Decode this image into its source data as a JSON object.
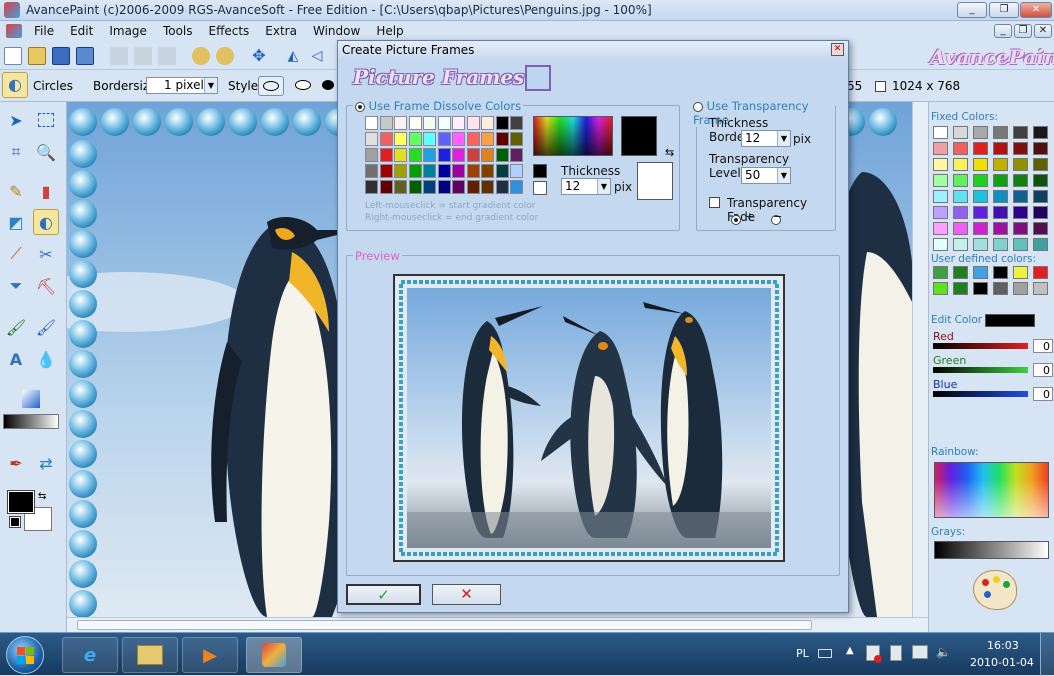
{
  "window": {
    "title": "AvancePaint (c)2006-2009 RGS-AvanceSoft - Free Edition - [C:\\Users\\qbap\\Pictures\\Penguins.jpg - 100%]",
    "controls": [
      "_",
      "❐",
      "✕"
    ],
    "inner_controls": [
      "_",
      "❐",
      "✕"
    ]
  },
  "menu": [
    "File",
    "Edit",
    "Image",
    "Tools",
    "Effects",
    "Extra",
    "Window",
    "Help"
  ],
  "brand": "AvancePaint",
  "toolbar2": {
    "tool_name": "Circles",
    "bordersize_label": "Bordersize:",
    "bordersize_value": "1 pixel",
    "style_label": "Style:",
    "coord_fragment": "55",
    "image_size": "1024 x 768"
  },
  "dialog": {
    "title": "Create Picture Frames",
    "logo_text": "Picture Frames",
    "dissolve": {
      "label": "Use Frame Dissolve Colors",
      "thickness_label": "Thickness",
      "thickness_value": "12",
      "unit": "pix",
      "hint_left": "Left-mouseclick = start gradient color",
      "hint_right": "Right-mouseclick = end gradient color"
    },
    "transparency": {
      "label": "Use Transparency Frame",
      "thickness_label": "Thickness",
      "border_label": "Border",
      "border_value": "12",
      "unit": "pix",
      "transparency_label": "Transparency",
      "level_label": "Level",
      "level_value": "50",
      "fade_label": "Transparency Fade",
      "plus": "+",
      "minus": "−"
    },
    "preview_label": "Preview",
    "ok_symbol": "✓",
    "cancel_symbol": "✕"
  },
  "right_panel": {
    "fixed_colors_label": "Fixed Colors:",
    "user_colors_label": "User defined colors:",
    "edit_color_label": "Edit Color",
    "red_label": "Red",
    "green_label": "Green",
    "blue_label": "Blue",
    "red_value": "0",
    "green_value": "0",
    "blue_value": "0",
    "rainbow_label": "Rainbow:",
    "grays_label": "Grays:"
  },
  "taskbar": {
    "lang": "PL",
    "time": "16:03",
    "date": "2010-01-04"
  },
  "palette_colors": [
    "#ffffff",
    "#c8c8c8",
    "#fff0f0",
    "#fffff0",
    "#f0fff0",
    "#f0ffff",
    "#fff0ff",
    "#ffe4f0",
    "#ffeedd",
    "#000000",
    "#404040",
    "#e0e0e0",
    "#f06060",
    "#ffff60",
    "#60ff60",
    "#60ffff",
    "#6060ff",
    "#ff60ff",
    "#ff6060",
    "#ffa040",
    "#600000",
    "#606000",
    "#a0a0a0",
    "#e02020",
    "#e0e020",
    "#20e020",
    "#20a0e0",
    "#2020e0",
    "#e020e0",
    "#d04040",
    "#e08020",
    "#006000",
    "#602060",
    "#707070",
    "#a00000",
    "#a0a000",
    "#00a000",
    "#0080a0",
    "#0000a0",
    "#a000a0",
    "#a04000",
    "#804000",
    "#004040",
    "#b0d0ff",
    "#303030",
    "#600000",
    "#606020",
    "#006000",
    "#004080",
    "#000080",
    "#600060",
    "#602000",
    "#603000",
    "#203040",
    "#3090e0"
  ],
  "fixed_colors": [
    "#ffffff",
    "#d8d8d8",
    "#a8a8a8",
    "#787878",
    "#404040",
    "#181818",
    "#f0a0a0",
    "#f06060",
    "#e02020",
    "#b01010",
    "#801010",
    "#501010",
    "#fff8a0",
    "#f8f060",
    "#f0e000",
    "#c0b000",
    "#909000",
    "#606000",
    "#a0ffa0",
    "#60f060",
    "#20d020",
    "#10a010",
    "#108010",
    "#105010",
    "#a0f0ff",
    "#60e0f0",
    "#20c0e0",
    "#1090c0",
    "#106090",
    "#104060",
    "#c0a0ff",
    "#9060f0",
    "#6020e0",
    "#4010b0",
    "#300090",
    "#200060",
    "#ffa0ff",
    "#f060f0",
    "#d020d0",
    "#a010a0",
    "#801080",
    "#501050",
    "#e0ffff",
    "#c0f0f0",
    "#a0e0e0",
    "#80d0d0",
    "#60c0c0",
    "#40a0a0"
  ],
  "user_colors": [
    "#40a040",
    "#208020",
    "#40a0e0",
    "#000000",
    "#f0f040",
    "#e02020",
    "#60e020",
    "#208020",
    "#000000",
    "#606060",
    "#a0a0a0",
    "#c0c0c0"
  ]
}
